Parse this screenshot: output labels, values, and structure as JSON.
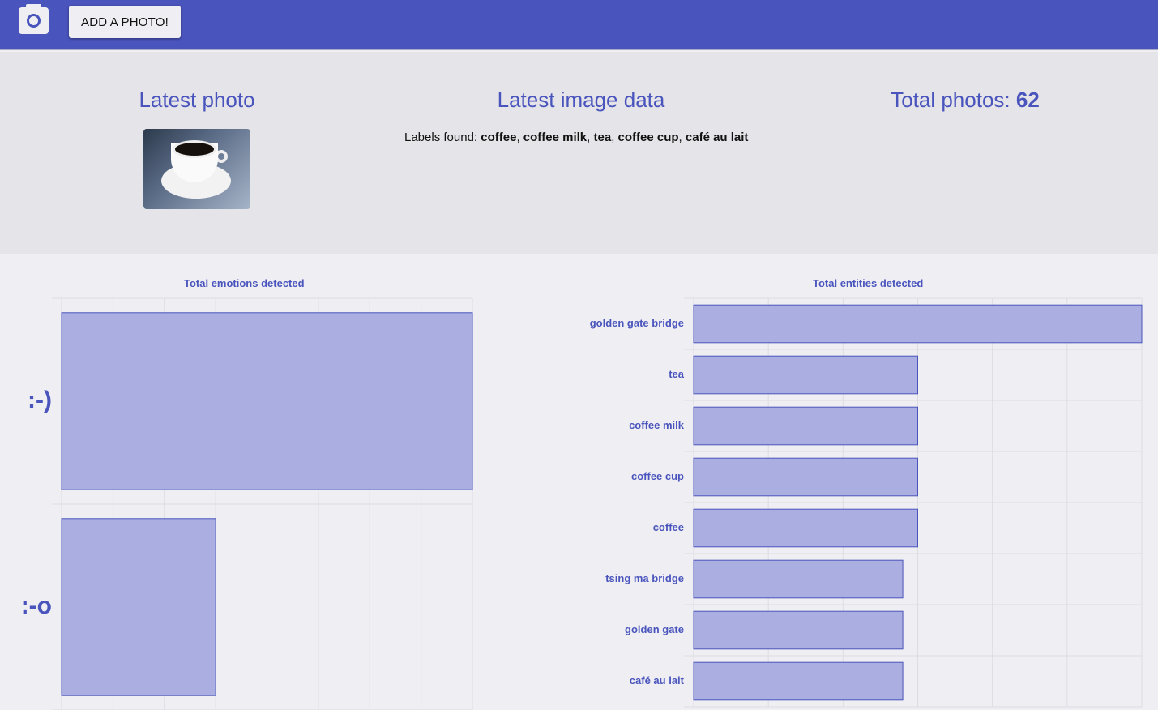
{
  "header": {
    "camera_icon": "camera-icon",
    "add_photo_label": "ADD A PHOTO!",
    "color": "#4a54bd"
  },
  "info": {
    "latest_photo_title": "Latest photo",
    "latest_data_title": "Latest image data",
    "total_photos_label": "Total photos: ",
    "total_photos_value": "62",
    "labels_prefix": "Labels found: ",
    "labels": [
      "coffee",
      "coffee milk",
      "tea",
      "coffee cup",
      "café au lait"
    ]
  },
  "chart_data": [
    {
      "type": "bar",
      "orientation": "horizontal",
      "title": "Total emotions detected",
      "categories": [
        ":-)",
        ":-o"
      ],
      "values": [
        8,
        3
      ],
      "xlim": [
        0,
        8
      ],
      "grid": true,
      "bar_color": "#aaaee0",
      "edge_color": "#4a54bd"
    },
    {
      "type": "bar",
      "orientation": "horizontal",
      "title": "Total entities detected",
      "categories": [
        "golden gate bridge",
        "tea",
        "coffee milk",
        "coffee cup",
        "coffee",
        "tsing ma bridge",
        "golden gate",
        "café au lait"
      ],
      "values": [
        6,
        3,
        3,
        3,
        3,
        2.8,
        2.8,
        2.8
      ],
      "xlim": [
        0,
        6
      ],
      "grid": true,
      "bar_color": "#aaaee0",
      "edge_color": "#4a54bd"
    }
  ]
}
